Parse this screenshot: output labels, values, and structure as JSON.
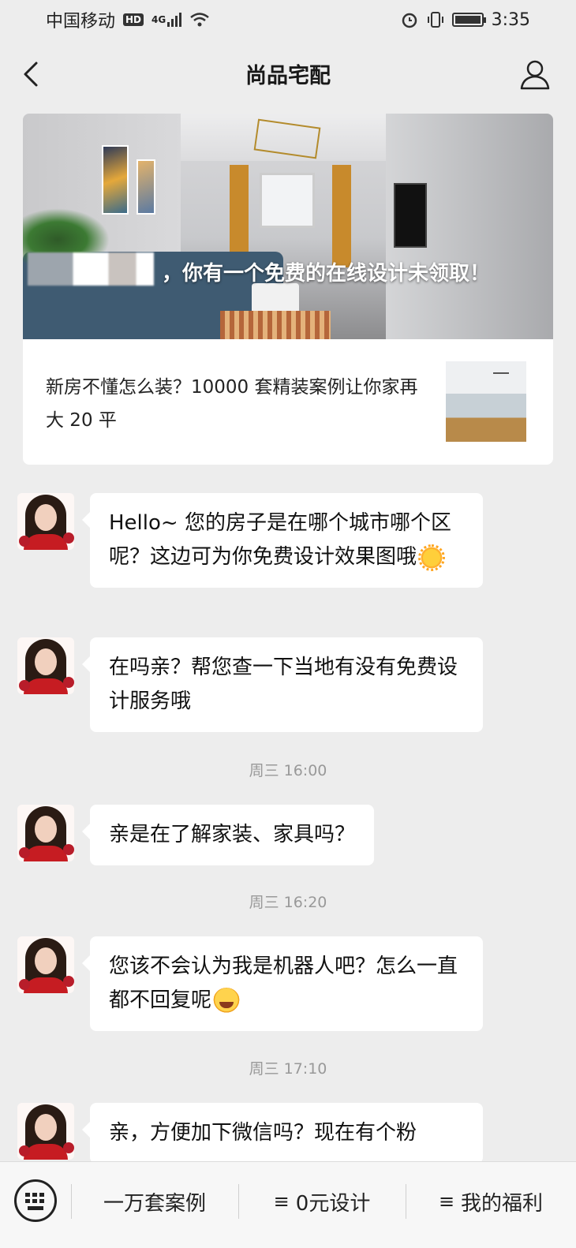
{
  "status_bar": {
    "carrier": "中国移动",
    "hd_badge": "HD",
    "network": "4G",
    "time": "3:35"
  },
  "nav": {
    "title": "尚品宅配",
    "back_icon": "chevron-left-icon",
    "profile_icon": "person-icon"
  },
  "article": {
    "overlay_text": "，你有一个免费的在线设计未领取！",
    "summary": "新房不懂怎么装？10000 套精装案例让你家再大 20 平"
  },
  "messages": [
    {
      "text": "Hello~ 您的房子是在哪个城市哪个区呢？这边可为你免费设计效果图哦",
      "emoji": "sun-emoji"
    },
    {
      "text": "在吗亲？帮您查一下当地有没有免费设计服务哦"
    },
    {
      "text": "亲是在了解家装、家具吗？"
    },
    {
      "text": "您该不会认为我是机器人吧？怎么一直都不回复呢",
      "emoji": "laughing-crying-emoji"
    },
    {
      "text": "亲，方便加下微信吗？现在有个粉"
    }
  ],
  "timestamps": [
    "周三 16:00",
    "周三 16:20",
    "周三 17:10"
  ],
  "bottom_menu": {
    "keyboard_icon": "keyboard-icon",
    "items": [
      {
        "label": "一万套案例",
        "icon": ""
      },
      {
        "label": "0元设计",
        "icon": "menu-lines-icon"
      },
      {
        "label": "我的福利",
        "icon": "menu-lines-icon"
      }
    ]
  },
  "colors": {
    "background": "#ededed",
    "bubble": "#ffffff",
    "timestamp": "#999999"
  }
}
